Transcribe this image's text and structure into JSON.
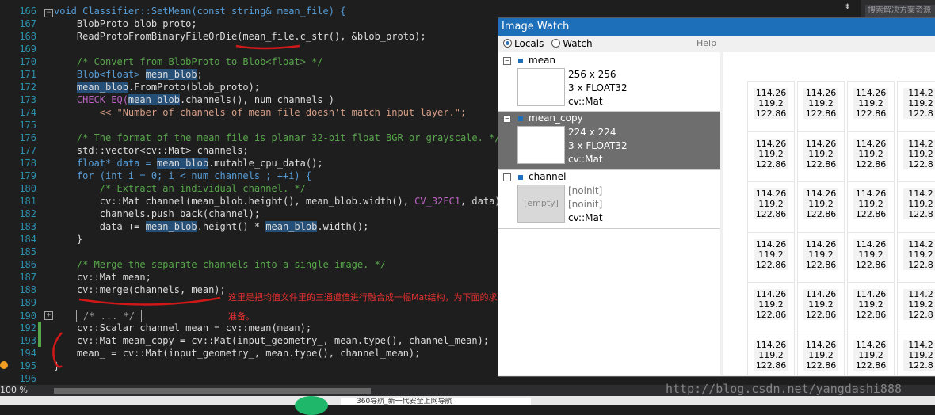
{
  "editor": {
    "line_numbers": [
      "166",
      "167",
      "168",
      "169",
      "170",
      "171",
      "172",
      "173",
      "174",
      "175",
      "176",
      "177",
      "178",
      "179",
      "180",
      "181",
      "182",
      "183",
      "184",
      "185",
      "186",
      "187",
      "188",
      "189",
      "190",
      "192",
      "193",
      "194",
      "195",
      "196"
    ],
    "line0": "void Classifier::SetMean(const string& mean_file) {",
    "line1": "    BlobProto blob_proto;",
    "line2": "    ReadProtoFromBinaryFileOrDie(mean_file.c_str(), &blob_proto);",
    "line4": "    /* Convert from BlobProto to Blob<float> */",
    "line5a": "    Blob<float> ",
    "line5b": "mean_blob",
    "line5c": ";",
    "line6a": "    ",
    "line6b": "mean_blob",
    "line6c": ".FromProto(blob_proto);",
    "line7a": "    CHECK_EQ(",
    "line7b": "mean_blob",
    "line7c": ".channels(), num_channels_)",
    "line8": "        << \"Number of channels of mean file doesn't match input layer.\";",
    "line10": "    /* The format of the mean file is planar 32-bit float BGR or grayscale. */",
    "line11": "    std::vector<cv::Mat> channels;",
    "line12a": "    float* data = ",
    "line12b": "mean_blob",
    "line12c": ".mutable_cpu_data();",
    "line13": "    for (int i = 0; i < num_channels_; ++i) {",
    "line14": "        /* Extract an individual channel. */",
    "line15a": "        cv::Mat channel(mean_blob.height(), mean_blob.width(), ",
    "line15b": "CV_32FC1",
    "line15c": ", data);",
    "line16": "        channels.push_back(channel);",
    "line17a": "        data += ",
    "line17b": "mean_blob",
    "line17c": ".height() * ",
    "line17d": "mean_blob",
    "line17e": ".width();",
    "line18": "    }",
    "line20": "    /* Merge the separate channels into a single image. */",
    "line21": "    cv::Mat mean;",
    "line22": "    cv::merge(channels, mean);",
    "line24": "/* ... */",
    "line25": "    cv::Scalar channel_mean = cv::mean(mean);",
    "line26": "    cv::Mat mean_copy = cv::Mat(input_geometry_, mean.type(), channel_mean);",
    "line27": "    mean_ = cv::Mat(input_geometry_, mean.type(), channel_mean);",
    "line28": "}",
    "annotation_line1": "这里是把均值文件里的三通道值进行融合成一幅Mat结构，为下面的求每个通道的均值做",
    "annotation_line2": "准备。"
  },
  "image_watch": {
    "title": "Image Watch",
    "tab_locals": "Locals",
    "tab_watch": "Watch",
    "help": "Help",
    "items": [
      {
        "name": "mean",
        "size": "256 x 256",
        "format": "3 x FLOAT32",
        "type": "cv::Mat"
      },
      {
        "name": "mean_copy",
        "size": "224 x 224",
        "format": "3 x FLOAT32",
        "type": "cv::Mat"
      },
      {
        "name": "channel",
        "size": "[noinit]",
        "format": "[noinit]",
        "type": "cv::Mat",
        "thumb": "[empty]"
      }
    ],
    "pixel_values": [
      "114.26",
      "119.2",
      "122.86"
    ],
    "pixel_values_clipped": [
      "114.2",
      "119.2",
      "122.8"
    ]
  },
  "topbar": {
    "search_placeholder": "搜索解决方案资源"
  },
  "status": {
    "zoom": "100 %"
  },
  "taskbar": {
    "tab_text": "360导航_新一代安全上网导航"
  },
  "watermark": "http://blog.csdn.net/yangdashi888",
  "colors": {
    "keyword": "#569cd6",
    "comment": "#57a64a",
    "string": "#d69d85",
    "macro": "#bd63c5",
    "highlight": "#264f78",
    "annotation": "#e83030",
    "title_bar": "#1e6fba"
  }
}
